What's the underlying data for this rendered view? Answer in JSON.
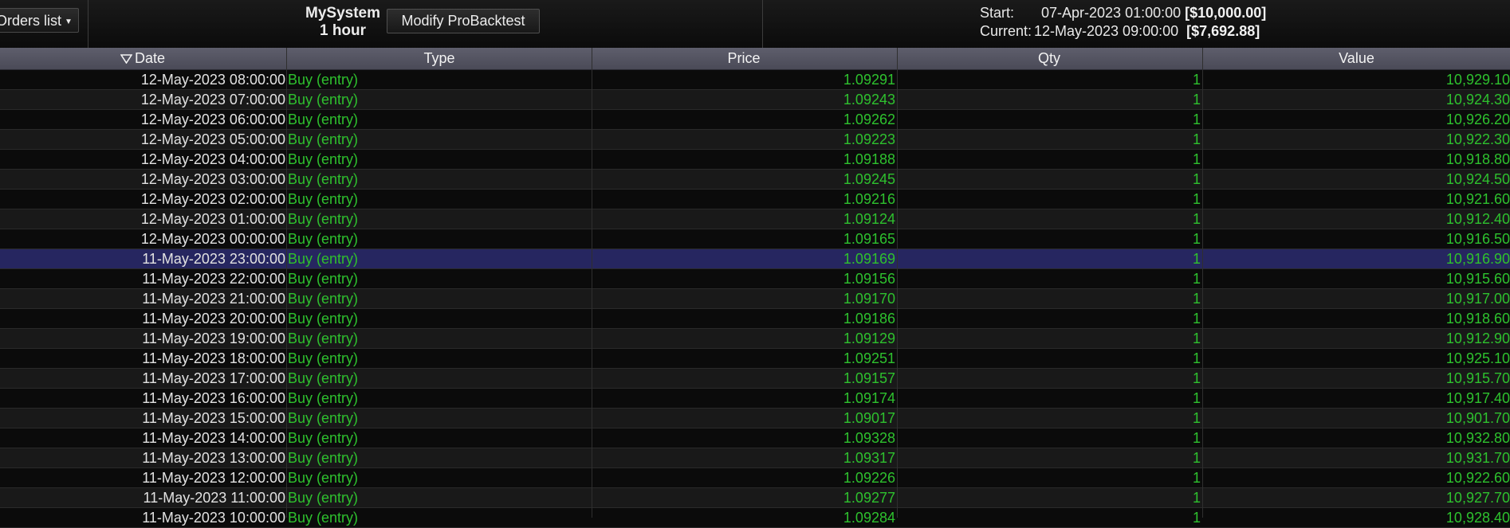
{
  "toolbar": {
    "orders_list_label": "Orders list",
    "system_name": "MySystem",
    "timeframe": "1 hour",
    "modify_button_label": "Modify ProBacktest",
    "start_label": "Start:",
    "start_date": "07-Apr-2023 01:00:00",
    "start_value": "[$10,000.00]",
    "current_label": "Current:",
    "current_date": "12-May-2023 09:00:00",
    "current_value": "[$7,692.88]"
  },
  "table": {
    "columns": [
      "Date",
      "Type",
      "Price",
      "Qty",
      "Value"
    ],
    "sort_column": "Date",
    "sort_direction": "descending",
    "selected_row_date": "11-May-2023 23:00:00",
    "rows": [
      {
        "date": "12-May-2023 08:00:00",
        "type": "Buy (entry)",
        "price": "1.09291",
        "qty": "1",
        "value": "10,929.10"
      },
      {
        "date": "12-May-2023 07:00:00",
        "type": "Buy (entry)",
        "price": "1.09243",
        "qty": "1",
        "value": "10,924.30"
      },
      {
        "date": "12-May-2023 06:00:00",
        "type": "Buy (entry)",
        "price": "1.09262",
        "qty": "1",
        "value": "10,926.20"
      },
      {
        "date": "12-May-2023 05:00:00",
        "type": "Buy (entry)",
        "price": "1.09223",
        "qty": "1",
        "value": "10,922.30"
      },
      {
        "date": "12-May-2023 04:00:00",
        "type": "Buy (entry)",
        "price": "1.09188",
        "qty": "1",
        "value": "10,918.80"
      },
      {
        "date": "12-May-2023 03:00:00",
        "type": "Buy (entry)",
        "price": "1.09245",
        "qty": "1",
        "value": "10,924.50"
      },
      {
        "date": "12-May-2023 02:00:00",
        "type": "Buy (entry)",
        "price": "1.09216",
        "qty": "1",
        "value": "10,921.60"
      },
      {
        "date": "12-May-2023 01:00:00",
        "type": "Buy (entry)",
        "price": "1.09124",
        "qty": "1",
        "value": "10,912.40"
      },
      {
        "date": "12-May-2023 00:00:00",
        "type": "Buy (entry)",
        "price": "1.09165",
        "qty": "1",
        "value": "10,916.50"
      },
      {
        "date": "11-May-2023 23:00:00",
        "type": "Buy (entry)",
        "price": "1.09169",
        "qty": "1",
        "value": "10,916.90"
      },
      {
        "date": "11-May-2023 22:00:00",
        "type": "Buy (entry)",
        "price": "1.09156",
        "qty": "1",
        "value": "10,915.60"
      },
      {
        "date": "11-May-2023 21:00:00",
        "type": "Buy (entry)",
        "price": "1.09170",
        "qty": "1",
        "value": "10,917.00"
      },
      {
        "date": "11-May-2023 20:00:00",
        "type": "Buy (entry)",
        "price": "1.09186",
        "qty": "1",
        "value": "10,918.60"
      },
      {
        "date": "11-May-2023 19:00:00",
        "type": "Buy (entry)",
        "price": "1.09129",
        "qty": "1",
        "value": "10,912.90"
      },
      {
        "date": "11-May-2023 18:00:00",
        "type": "Buy (entry)",
        "price": "1.09251",
        "qty": "1",
        "value": "10,925.10"
      },
      {
        "date": "11-May-2023 17:00:00",
        "type": "Buy (entry)",
        "price": "1.09157",
        "qty": "1",
        "value": "10,915.70"
      },
      {
        "date": "11-May-2023 16:00:00",
        "type": "Buy (entry)",
        "price": "1.09174",
        "qty": "1",
        "value": "10,917.40"
      },
      {
        "date": "11-May-2023 15:00:00",
        "type": "Buy (entry)",
        "price": "1.09017",
        "qty": "1",
        "value": "10,901.70"
      },
      {
        "date": "11-May-2023 14:00:00",
        "type": "Buy (entry)",
        "price": "1.09328",
        "qty": "1",
        "value": "10,932.80"
      },
      {
        "date": "11-May-2023 13:00:00",
        "type": "Buy (entry)",
        "price": "1.09317",
        "qty": "1",
        "value": "10,931.70"
      },
      {
        "date": "11-May-2023 12:00:00",
        "type": "Buy (entry)",
        "price": "1.09226",
        "qty": "1",
        "value": "10,922.60"
      },
      {
        "date": "11-May-2023 11:00:00",
        "type": "Buy (entry)",
        "price": "1.09277",
        "qty": "1",
        "value": "10,927.70"
      },
      {
        "date": "11-May-2023 10:00:00",
        "type": "Buy (entry)",
        "price": "1.09284",
        "qty": "1",
        "value": "10,928.40"
      }
    ]
  },
  "colors": {
    "background": "#000000",
    "row_odd": "#0b0b0b",
    "row_even": "#191919",
    "selected_row": "#262660",
    "header": "#545461",
    "positive_text": "#2ec12e",
    "date_text": "#e2e2e2"
  },
  "icons": {
    "orders_dropdown": "chevron-down-icon",
    "sort_indicator": "sort-descending-icon"
  }
}
